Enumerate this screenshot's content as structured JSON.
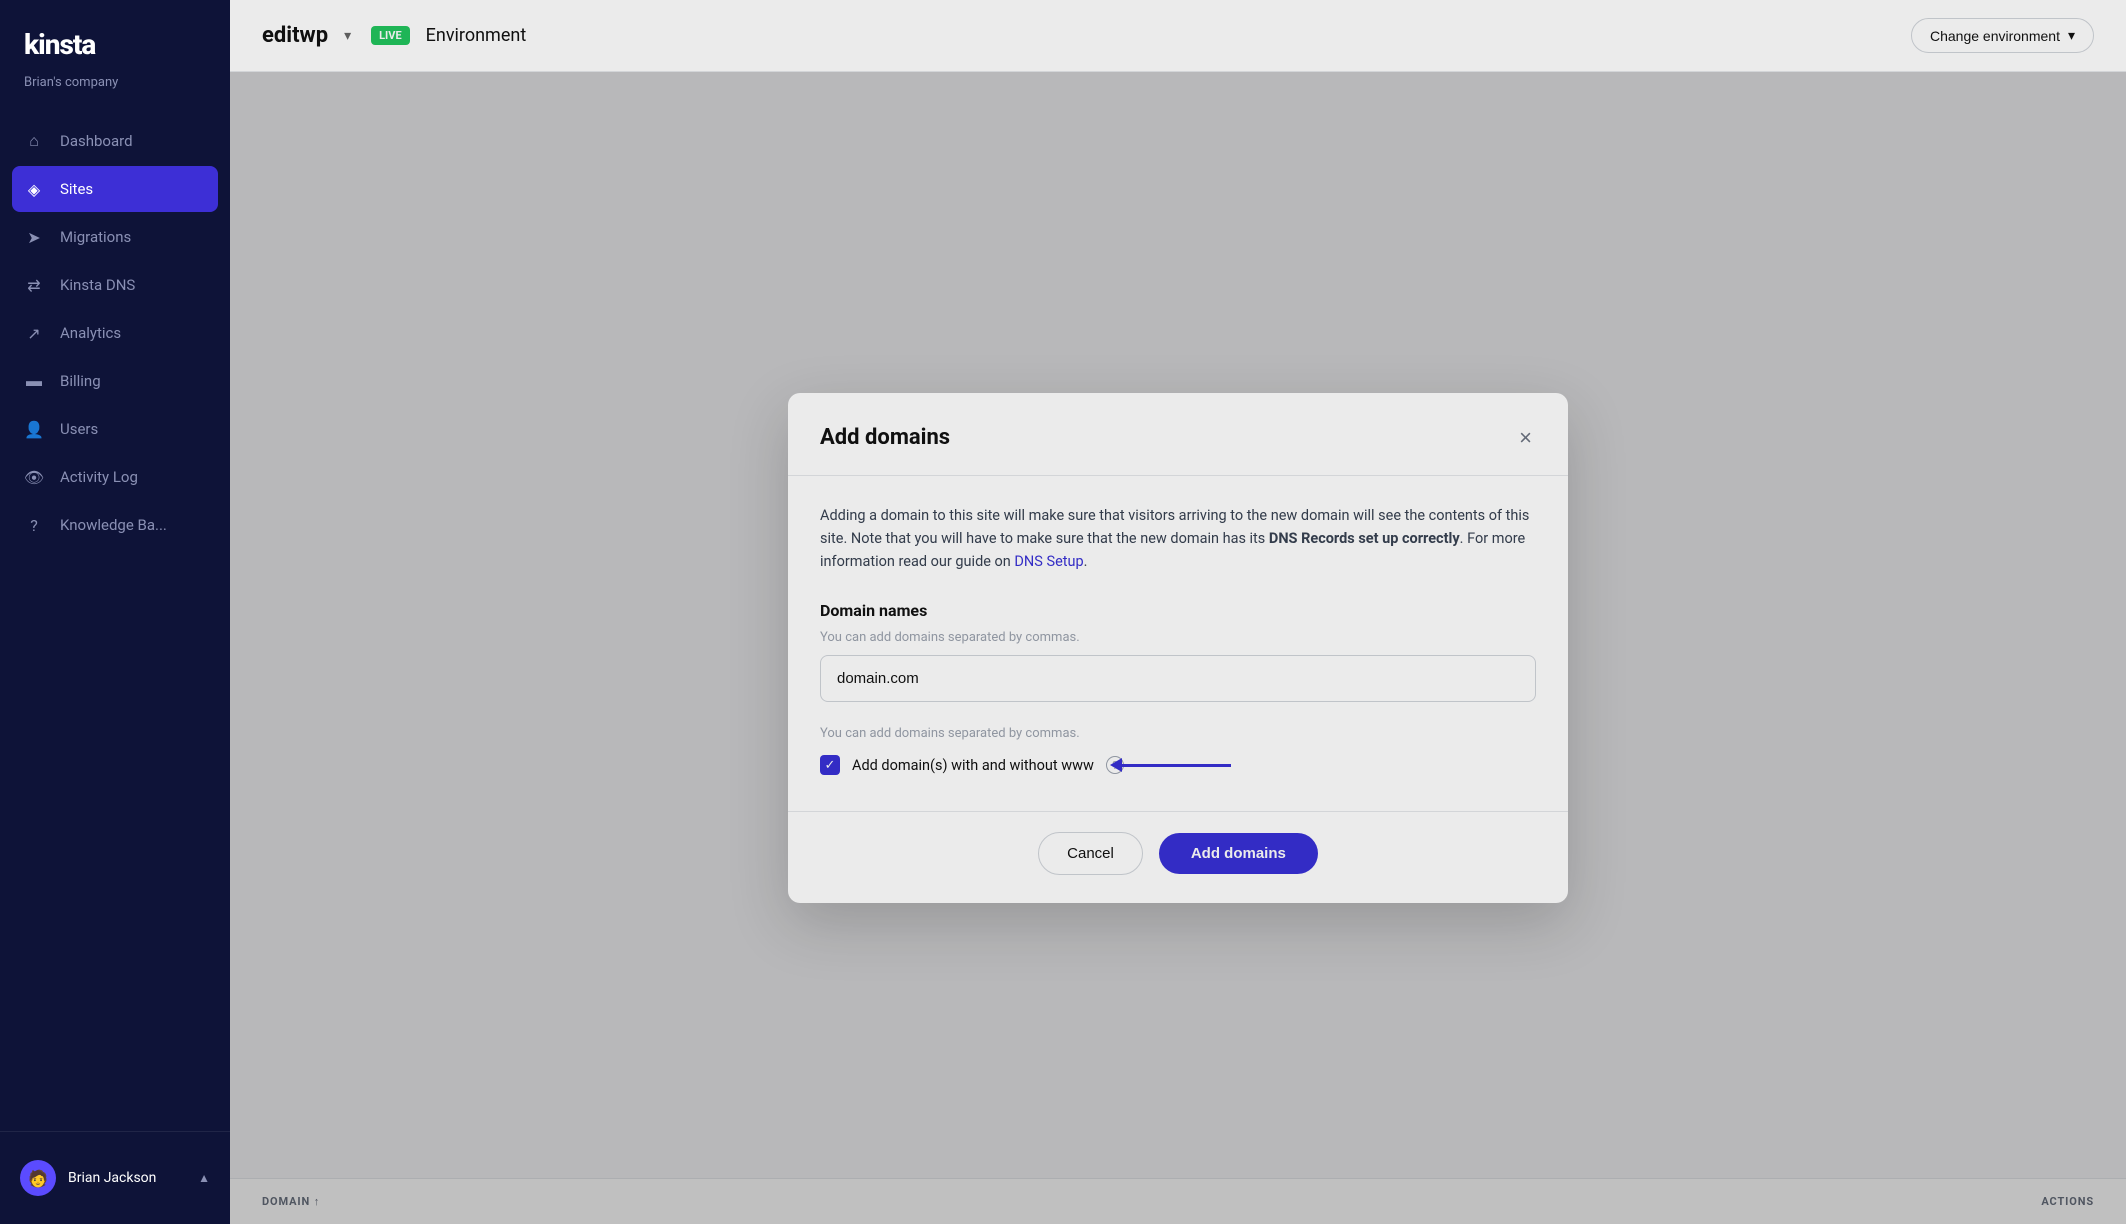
{
  "sidebar": {
    "logo": "kinsta",
    "company": "Brian's company",
    "nav": [
      {
        "id": "dashboard",
        "label": "Dashboard",
        "icon": "⌂",
        "active": false
      },
      {
        "id": "sites",
        "label": "Sites",
        "icon": "◈",
        "active": true
      },
      {
        "id": "migrations",
        "label": "Migrations",
        "icon": "➤",
        "active": false
      },
      {
        "id": "kinsta-dns",
        "label": "Kinsta DNS",
        "icon": "⇄",
        "active": false
      },
      {
        "id": "analytics",
        "label": "Analytics",
        "icon": "↗",
        "active": false
      },
      {
        "id": "billing",
        "label": "Billing",
        "icon": "▬",
        "active": false
      },
      {
        "id": "users",
        "label": "Users",
        "icon": "👤",
        "active": false
      },
      {
        "id": "activity-log",
        "label": "Activity Log",
        "icon": "👁",
        "active": false
      },
      {
        "id": "knowledge-base",
        "label": "Knowledge Ba...",
        "icon": "?",
        "active": false
      }
    ],
    "user": {
      "name": "Brian Jackson",
      "avatar": "🧑"
    }
  },
  "topbar": {
    "site_name": "editwp",
    "live_badge": "LIVE",
    "environment_label": "Environment",
    "change_env_label": "Change environment"
  },
  "table": {
    "col_domain": "DOMAIN ↑",
    "col_actions": "ACTIONS"
  },
  "modal": {
    "title": "Add domains",
    "description_part1": "Adding a domain to this site will make sure that visitors arriving to the new domain will see the contents of this site. Note that you will have to make sure that the new domain has its ",
    "description_bold": "DNS Records set up correctly",
    "description_part2": ". For more information read our guide on ",
    "dns_link_text": "DNS Setup",
    "domain_names_label": "Domain names",
    "input_hint": "You can add domains separated by commas.",
    "input_value": "domain.com",
    "input_placeholder": "domain.com",
    "input_hint2": "You can add domains separated by commas.",
    "checkbox_label": "Add domain(s) with and without www",
    "cancel_label": "Cancel",
    "add_domains_label": "Add domains",
    "close_icon": "×"
  }
}
